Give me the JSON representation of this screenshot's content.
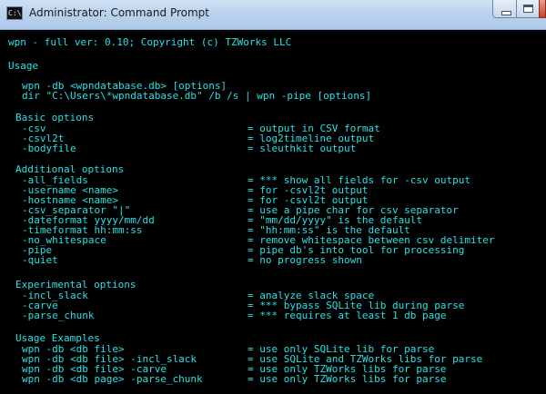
{
  "window": {
    "title": "Administrator: Command Prompt",
    "icon": "console-app-icon",
    "icon_glyph": "C:\\",
    "colors": {
      "console_bg": "#000000",
      "console_text": "#27e1e6"
    }
  },
  "console": {
    "header": "wpn - full ver: 0.10; Copyright (c) TZWorks LLC",
    "usage_heading": "Usage",
    "usage_lines": [
      "wpn -db <wpndatabase.db> [options]",
      "dir \"C:\\Users\\*wpndatabase.db\" /b /s | wpn -pipe [options]"
    ],
    "basic_heading": "Basic options",
    "basic_options": [
      {
        "opt": "-csv",
        "desc": "= output in CSV format"
      },
      {
        "opt": "-csvl2t",
        "desc": "= log2timeline output"
      },
      {
        "opt": "-bodyfile",
        "desc": "= sleuthkit output"
      }
    ],
    "additional_heading": "Additional options",
    "additional_options": [
      {
        "opt": "-all_fields",
        "desc": "= *** show all fields for -csv output"
      },
      {
        "opt": "-username <name>",
        "desc": "= for -csvl2t output"
      },
      {
        "opt": "-hostname <name>",
        "desc": "= for -csvl2t output"
      },
      {
        "opt": "-csv_separator \"|\"",
        "desc": "= use a pipe char for csv separator"
      },
      {
        "opt": "-dateformat yyyy/mm/dd",
        "desc": "= \"mm/dd/yyyy\" is the default"
      },
      {
        "opt": "-timeformat hh:mm:ss",
        "desc": "= \"hh:mm:ss\" is the default"
      },
      {
        "opt": "-no_whitespace",
        "desc": "= remove whitespace between csv delimiter"
      },
      {
        "opt": "-pipe",
        "desc": "= pipe db's into tool for processing"
      },
      {
        "opt": "-quiet",
        "desc": "= no progress shown"
      }
    ],
    "experimental_heading": "Experimental options",
    "experimental_options": [
      {
        "opt": "-incl_slack",
        "desc": "= analyze slack space"
      },
      {
        "opt": "-carve",
        "desc": "= *** bypass SQLite lib during parse"
      },
      {
        "opt": "-parse_chunk",
        "desc": "= *** requires at least 1 db page"
      }
    ],
    "examples_heading": "Usage Examples",
    "examples": [
      {
        "opt": "wpn -db <db file>",
        "desc": "= use only SQLite lib for parse"
      },
      {
        "opt": "wpn -db <db file> -incl_slack",
        "desc": "= use SQLite and TZWorks libs for parse"
      },
      {
        "opt": "wpn -db <db file> -carve",
        "desc": "= use only TZWorks libs for parse"
      },
      {
        "opt": "wpn -db <db page> -parse_chunk",
        "desc": "= use only TZWorks libs for parse"
      }
    ]
  }
}
